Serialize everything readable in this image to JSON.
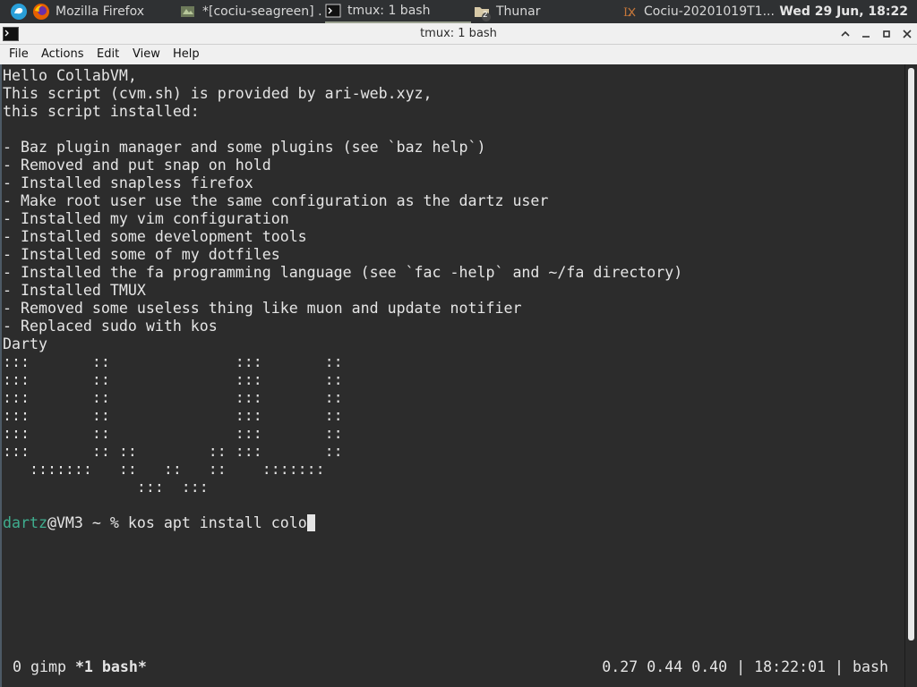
{
  "taskbar": {
    "tasks": [
      {
        "label": "Mozilla Firefox",
        "icon": "firefox-icon"
      },
      {
        "label": "*[cociu-seagreen] ...",
        "icon": "gimp-icon"
      },
      {
        "label": "tmux: 1 bash",
        "icon": "terminal-icon"
      },
      {
        "label": "Thunar",
        "icon": "folder-icon",
        "badge": "2"
      },
      {
        "label": "Cociu-20201019T1...",
        "icon": "lyx-icon"
      }
    ],
    "clock": "Wed 29 Jun, 18:22"
  },
  "window": {
    "title": "tmux: 1 bash"
  },
  "menubar": {
    "items": [
      "File",
      "Actions",
      "Edit",
      "View",
      "Help"
    ]
  },
  "terminal": {
    "lines": [
      "Hello CollabVM,",
      "This script (cvm.sh) is provided by ari-web.xyz,",
      "this script installed:",
      "",
      "- Baz plugin manager and some plugins (see `baz help`)",
      "- Removed and put snap on hold",
      "- Installed snapless firefox",
      "- Make root user use the same configuration as the dartz user",
      "- Installed my vim configuration",
      "- Installed some development tools",
      "- Installed some of my dotfiles",
      "- Installed the fa programming language (see `fac -help` and ~/fa directory)",
      "- Installed TMUX",
      "- Removed some useless thing like muon and update notifier",
      "- Replaced sudo with kos",
      "Darty",
      ":::       ::              :::       ::",
      ":::       ::              :::       ::",
      ":::       ::              :::       ::",
      ":::       ::              :::       ::",
      ":::       ::              :::       ::",
      ":::       :: ::        :: :::       ::",
      "   :::::::   ::   ::   ::    :::::::",
      "               :::  :::",
      ""
    ],
    "prompt": {
      "user": "dartz",
      "rest": "@VM3 ~ % ",
      "command": "kos apt install colo"
    },
    "status_left": {
      "prefix": "0 gimp ",
      "current": "*1 bash*"
    },
    "status_right": "0.27 0.44 0.40 | 18:22:01 | bash"
  },
  "colors": {
    "prompt_user": "#3fae8f",
    "terminal_bg": "#2c2c2c",
    "taskbar_bg": "#2f3133"
  }
}
